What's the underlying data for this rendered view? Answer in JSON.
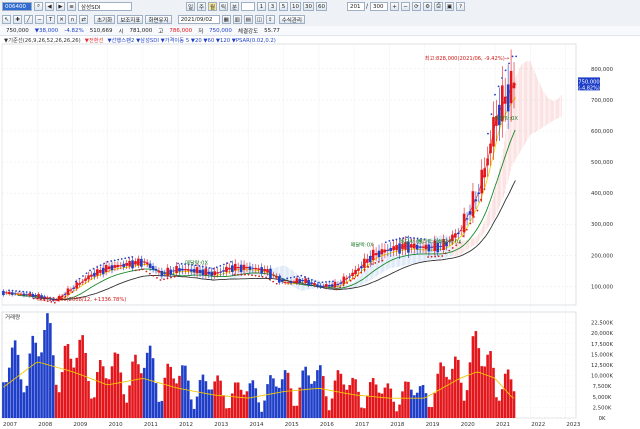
{
  "toolbar": {
    "code": "006400",
    "name": "삼성SDI",
    "period_buttons": [
      "일",
      "주",
      "월",
      "틱",
      "분"
    ],
    "interval_buttons": [
      "1",
      "3",
      "5",
      "10",
      "30",
      "60"
    ],
    "date": "2021/09/02",
    "count": "201",
    "count_total": "300",
    "row2_buttons": [
      "초기화",
      "보조지표",
      "화면유지"
    ],
    "tools": [
      "수식관리"
    ]
  },
  "infobar": {
    "items": [
      "750,000",
      "▼38,000",
      "-4.82%",
      "510,669",
      "시",
      "781,000",
      "고",
      "786,000",
      "저",
      "750,000",
      "체결강도",
      "55.77"
    ]
  },
  "legend": {
    "left": "▼기준선(26,9,26,52,26,26,26)",
    "middle": "▼전환선",
    "right": "▼선행스팬2 ▼삼성SDI ▼가격이동 5 ▼20 ▼60 ▼120 ▼PSAR(0.02,0.2)"
  },
  "colors": {
    "up": "#e3161b",
    "down": "#1f3fc8",
    "ma5": "#e03030",
    "ma20": "#f0d000",
    "ma60": "#1a8a2a",
    "ma120": "#333333",
    "vol_ma": "#f0c800",
    "cloud": "#e85050",
    "cloud_lagging": "#3d7fd6",
    "psar": "#d02020",
    "psar_down": "#2a40c0",
    "annotation": "#d01515",
    "label_green": "#1a7a2a"
  },
  "chart_data": [
    {
      "type": "candlestick",
      "title": "삼성SDI",
      "x_ticks": [
        "2007",
        "2008",
        "2009",
        "2010",
        "2011",
        "2012",
        "2013",
        "2014",
        "2015",
        "2016",
        "2017",
        "2018",
        "2019",
        "2020",
        "2021",
        "2022",
        "2023"
      ],
      "y_ticks": [
        "100,000",
        "200,000",
        "300,000",
        "400,000",
        "500,000",
        "600,000",
        "700,000",
        "800,000"
      ],
      "ylim": [
        40000,
        880000
      ],
      "xlim": [
        2007.0,
        2023.3
      ],
      "last_price_label": "750,000",
      "last_change_label": "(-4.82%)",
      "annotations": [
        {
          "text": "최고:828,000(2021/06, -9.42%)→",
          "color": "annotation",
          "x": 2021.4,
          "y": 828000
        },
        {
          "text": "최저:52,200(2008/12, +1336.78%)",
          "color": "annotation",
          "x": 2008.0,
          "y": 52200
        },
        {
          "text": "매달락:0X",
          "color": "label_green",
          "x": 2012.2,
          "y": 170000
        },
        {
          "text": "매달락:0X",
          "color": "label_green",
          "x": 2016.9,
          "y": 228000
        },
        {
          "text": "배당락:0X",
          "color": "label_green",
          "x": 2018.3,
          "y": 238000
        },
        {
          "text": "권리락:0X",
          "color": "label_green",
          "x": 2018.8,
          "y": 240000
        },
        {
          "text": "배당락:0X",
          "color": "label_green",
          "x": 2019.4,
          "y": 238000
        },
        {
          "text": "배당락:0X",
          "color": "label_green",
          "x": 2021.0,
          "y": 635000
        }
      ],
      "series": [
        {
          "name": "close",
          "color_key": "up",
          "x": [
            2007.0,
            2007.5,
            2008.0,
            2008.5,
            2009.0,
            2009.5,
            2010.0,
            2010.5,
            2011.0,
            2011.5,
            2012.0,
            2012.5,
            2013.0,
            2013.5,
            2014.0,
            2014.5,
            2015.0,
            2015.5,
            2016.0,
            2016.5,
            2017.0,
            2017.5,
            2018.0,
            2018.5,
            2019.0,
            2019.5,
            2020.0,
            2020.5,
            2020.75,
            2021.0,
            2021.25,
            2021.5
          ],
          "y": [
            80000,
            75000,
            70000,
            55000,
            95000,
            135000,
            160000,
            170000,
            180000,
            140000,
            155000,
            150000,
            140000,
            160000,
            160000,
            150000,
            110000,
            120000,
            100000,
            105000,
            145000,
            200000,
            220000,
            230000,
            225000,
            230000,
            280000,
            400000,
            500000,
            640000,
            700000,
            750000
          ]
        }
      ]
    },
    {
      "type": "bar",
      "title": "거래량",
      "x_ticks": [
        "2007",
        "2008",
        "2009",
        "2010",
        "2011",
        "2012",
        "2013",
        "2014",
        "2015",
        "2016",
        "2017",
        "2018",
        "2019",
        "2020",
        "2021",
        "2022",
        "2023"
      ],
      "y_ticks": [
        "0K",
        "2,500K",
        "5,000K",
        "7,500K",
        "10,000K",
        "12,500K",
        "15,000K",
        "17,500K",
        "20,000K",
        "22,500K"
      ],
      "ylim": [
        0,
        25000000
      ],
      "series": [
        {
          "name": "거래량",
          "x": [
            2007.0,
            2008.0,
            2009.0,
            2010.0,
            2011.0,
            2012.0,
            2013.0,
            2014.0,
            2015.0,
            2016.0,
            2017.0,
            2018.0,
            2019.0,
            2020.0,
            2020.5,
            2021.0,
            2021.5
          ],
          "values": [
            9000000,
            17000000,
            14000000,
            10000000,
            12000000,
            9000000,
            7000000,
            6000000,
            8000000,
            9000000,
            7000000,
            6000000,
            6000000,
            12000000,
            14000000,
            12000000,
            6000000
          ]
        }
      ]
    }
  ]
}
